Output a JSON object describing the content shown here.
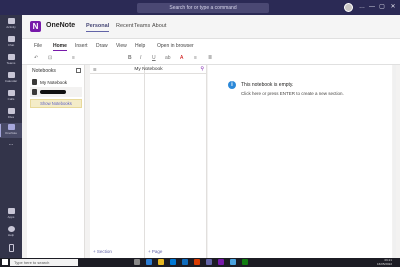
{
  "topbar": {
    "search_placeholder": "Search for or type a command",
    "window_controls": [
      "…",
      "—",
      "▢",
      "✕"
    ]
  },
  "rail": [
    {
      "icon": "activity-icon",
      "label": "Activity"
    },
    {
      "icon": "chat-icon",
      "label": "Chat"
    },
    {
      "icon": "teams-icon",
      "label": "Teams"
    },
    {
      "icon": "calendar-icon",
      "label": "Calendar"
    },
    {
      "icon": "calls-icon",
      "label": "Calls"
    },
    {
      "icon": "files-icon",
      "label": "Files"
    },
    {
      "icon": "onenote-icon",
      "label": "OneNote"
    },
    {
      "icon": "more-icon",
      "label": "..."
    }
  ],
  "rail_bottom": [
    {
      "icon": "apps-icon",
      "label": "Apps"
    },
    {
      "icon": "help-icon",
      "label": "Help"
    }
  ],
  "header": {
    "app_icon_letter": "N",
    "app_title": "OneNote",
    "tabs": [
      "Personal",
      "Recent",
      "Teams",
      "About"
    ]
  },
  "ribbon": {
    "tabs": [
      "File",
      "Home",
      "Insert",
      "Draw",
      "View",
      "Help",
      "Open in browser"
    ],
    "tools": [
      "↶",
      "⊡",
      "≡",
      "B",
      "I",
      "U",
      "ab",
      "A",
      "≡",
      "≣"
    ]
  },
  "notebooks": {
    "header": "Notebooks",
    "items": [
      "My Notebook"
    ],
    "show_button": "Show Notebooks"
  },
  "sections": {
    "header": "My Notebook",
    "add_section": "+ Section",
    "add_page": "+ Page"
  },
  "canvas": {
    "title": "This notebook is empty.",
    "subtitle": "Click here or press ENTER to create a new section."
  },
  "taskbar": {
    "search_placeholder": "Type here to search",
    "time": "09:21",
    "date": "16/05/2022"
  },
  "colors": {
    "teams_purple": "#6264a7",
    "onenote_purple": "#7719aa",
    "rail_bg": "#33344a"
  }
}
